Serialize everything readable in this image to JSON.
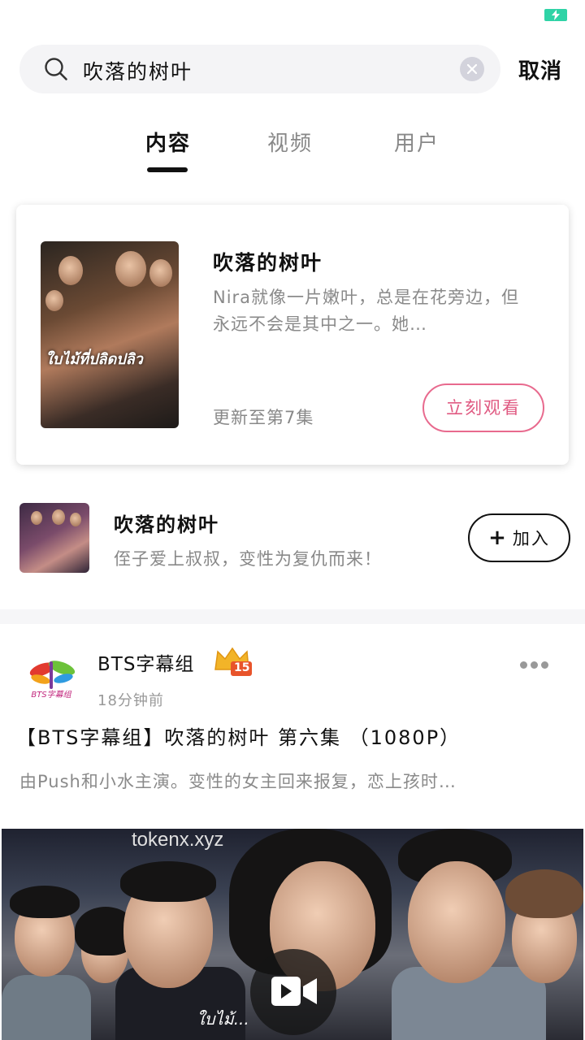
{
  "search": {
    "query": "吹落的树叶",
    "cancel_label": "取消"
  },
  "tabs": [
    {
      "label": "内容",
      "active": true
    },
    {
      "label": "视频",
      "active": false
    },
    {
      "label": "用户",
      "active": false
    }
  ],
  "featured": {
    "title": "吹落的树叶",
    "description": "Nira就像一片嫩叶，总是在花旁边，但永远不会是其中之一。她…",
    "update_status": "更新至第7集",
    "watch_label": "立刻观看",
    "poster_text": "ใบไม้ที่ปลิดปลิว"
  },
  "group": {
    "title": "吹落的树叶",
    "description": "侄子爱上叔叔，变性为复仇而来！",
    "join_label": "加入"
  },
  "post": {
    "author": "BTS字幕组",
    "avatar_text": "BTS字幕组",
    "level": "15",
    "time": "18分钟前",
    "title": "【BTS字幕组】吹落的树叶 第六集 （1080P）",
    "description": "由Push和小水主演。变性的女主回来报复，恋上孩时…",
    "watermark": "tokenx.xyz",
    "video_caption": "ใบไม้..."
  },
  "colors": {
    "accent_pink": "#e05a82",
    "battery_green": "#2fd3a6",
    "level_gold": "#f2b428"
  }
}
